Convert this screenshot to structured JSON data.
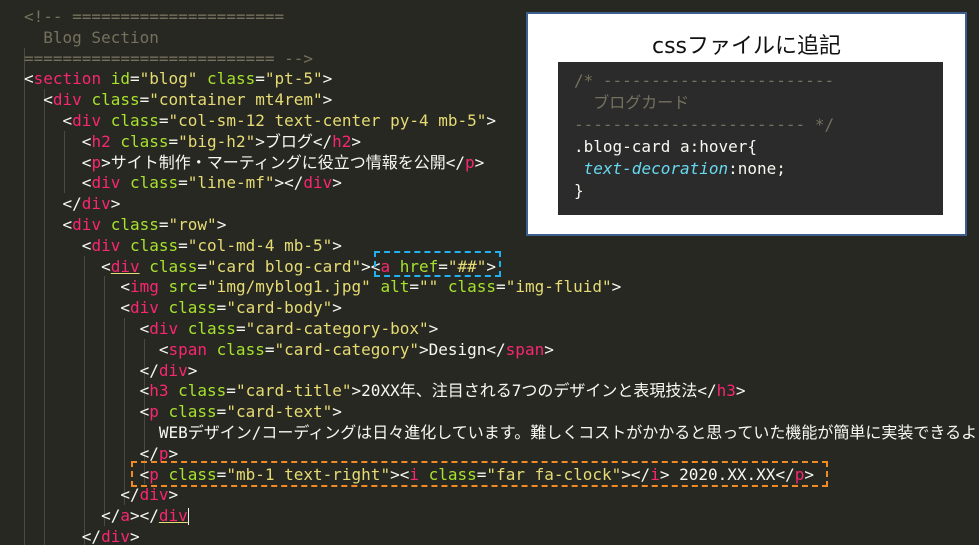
{
  "editor": {
    "lines": [
      [
        {
          "c": "cm",
          "t": "<!-- ======================"
        }
      ],
      [
        {
          "c": "cm",
          "t": "  Blog Section"
        }
      ],
      [
        {
          "c": "cm",
          "t": "========================== -->"
        }
      ],
      [
        {
          "c": "pu",
          "t": "<"
        },
        {
          "c": "tg",
          "t": "section"
        },
        {
          "c": "at",
          "t": " id"
        },
        {
          "c": "pu",
          "t": "="
        },
        {
          "c": "st",
          "t": "\"blog\""
        },
        {
          "c": "at",
          "t": " class"
        },
        {
          "c": "pu",
          "t": "="
        },
        {
          "c": "st",
          "t": "\"pt-5\""
        },
        {
          "c": "pu",
          "t": ">"
        }
      ],
      [
        {
          "c": "pu",
          "t": "  <"
        },
        {
          "c": "tg",
          "t": "div"
        },
        {
          "c": "at",
          "t": " class"
        },
        {
          "c": "pu",
          "t": "="
        },
        {
          "c": "st",
          "t": "\"container mt4rem\""
        },
        {
          "c": "pu",
          "t": ">"
        }
      ],
      [
        {
          "c": "pu",
          "t": "    <"
        },
        {
          "c": "tg",
          "t": "div"
        },
        {
          "c": "at",
          "t": " class"
        },
        {
          "c": "pu",
          "t": "="
        },
        {
          "c": "st",
          "t": "\"col-sm-12 text-center py-4 mb-5\""
        },
        {
          "c": "pu",
          "t": ">"
        }
      ],
      [
        {
          "c": "pu",
          "t": "      <"
        },
        {
          "c": "tg",
          "t": "h2"
        },
        {
          "c": "at",
          "t": " class"
        },
        {
          "c": "pu",
          "t": "="
        },
        {
          "c": "st",
          "t": "\"big-h2\""
        },
        {
          "c": "pu",
          "t": ">"
        },
        {
          "c": "tx",
          "t": "ブログ"
        },
        {
          "c": "pu",
          "t": "</"
        },
        {
          "c": "tg",
          "t": "h2"
        },
        {
          "c": "pu",
          "t": ">"
        }
      ],
      [
        {
          "c": "pu",
          "t": "      <"
        },
        {
          "c": "tg",
          "t": "p"
        },
        {
          "c": "pu",
          "t": ">"
        },
        {
          "c": "tx",
          "t": "サイト制作・マーティングに役立つ情報を公開"
        },
        {
          "c": "pu",
          "t": "</"
        },
        {
          "c": "tg",
          "t": "p"
        },
        {
          "c": "pu",
          "t": ">"
        }
      ],
      [
        {
          "c": "pu",
          "t": "      <"
        },
        {
          "c": "tg",
          "t": "div"
        },
        {
          "c": "at",
          "t": " class"
        },
        {
          "c": "pu",
          "t": "="
        },
        {
          "c": "st",
          "t": "\"line-mf\""
        },
        {
          "c": "pu",
          "t": "></"
        },
        {
          "c": "tg",
          "t": "div"
        },
        {
          "c": "pu",
          "t": ">"
        }
      ],
      [
        {
          "c": "pu",
          "t": "    </"
        },
        {
          "c": "tg",
          "t": "div"
        },
        {
          "c": "pu",
          "t": ">"
        }
      ],
      [
        {
          "c": "pu",
          "t": "    <"
        },
        {
          "c": "tg",
          "t": "div"
        },
        {
          "c": "at",
          "t": " class"
        },
        {
          "c": "pu",
          "t": "="
        },
        {
          "c": "st",
          "t": "\"row\""
        },
        {
          "c": "pu",
          "t": ">"
        }
      ],
      [
        {
          "c": "pu",
          "t": "      <"
        },
        {
          "c": "tg",
          "t": "div"
        },
        {
          "c": "at",
          "t": " class"
        },
        {
          "c": "pu",
          "t": "="
        },
        {
          "c": "st",
          "t": "\"col-md-4 mb-5\""
        },
        {
          "c": "pu",
          "t": ">"
        }
      ],
      [
        {
          "c": "pu",
          "t": "        <"
        },
        {
          "c": "tg ul",
          "t": "div"
        },
        {
          "c": "at",
          "t": " class"
        },
        {
          "c": "pu",
          "t": "="
        },
        {
          "c": "st",
          "t": "\"card blog-card\""
        },
        {
          "c": "pu",
          "t": "><"
        },
        {
          "c": "tg",
          "t": "a"
        },
        {
          "c": "at",
          "t": " href"
        },
        {
          "c": "pu",
          "t": "="
        },
        {
          "c": "st",
          "t": "\"##\""
        },
        {
          "c": "pu",
          "t": ">"
        }
      ],
      [
        {
          "c": "pu",
          "t": "          <"
        },
        {
          "c": "tg",
          "t": "img"
        },
        {
          "c": "at",
          "t": " src"
        },
        {
          "c": "pu",
          "t": "="
        },
        {
          "c": "st",
          "t": "\"img/myblog1.jpg\""
        },
        {
          "c": "at",
          "t": " alt"
        },
        {
          "c": "pu",
          "t": "="
        },
        {
          "c": "st",
          "t": "\"\""
        },
        {
          "c": "at",
          "t": " class"
        },
        {
          "c": "pu",
          "t": "="
        },
        {
          "c": "st",
          "t": "\"img-fluid\""
        },
        {
          "c": "pu",
          "t": ">"
        }
      ],
      [
        {
          "c": "pu",
          "t": "          <"
        },
        {
          "c": "tg",
          "t": "div"
        },
        {
          "c": "at",
          "t": " class"
        },
        {
          "c": "pu",
          "t": "="
        },
        {
          "c": "st",
          "t": "\"card-body\""
        },
        {
          "c": "pu",
          "t": ">"
        }
      ],
      [
        {
          "c": "pu",
          "t": "            <"
        },
        {
          "c": "tg",
          "t": "div"
        },
        {
          "c": "at",
          "t": " class"
        },
        {
          "c": "pu",
          "t": "="
        },
        {
          "c": "st",
          "t": "\"card-category-box\""
        },
        {
          "c": "pu",
          "t": ">"
        }
      ],
      [
        {
          "c": "pu",
          "t": "              <"
        },
        {
          "c": "tg",
          "t": "span"
        },
        {
          "c": "at",
          "t": " class"
        },
        {
          "c": "pu",
          "t": "="
        },
        {
          "c": "st",
          "t": "\"card-category\""
        },
        {
          "c": "pu",
          "t": ">"
        },
        {
          "c": "tx",
          "t": "Design"
        },
        {
          "c": "pu",
          "t": "</"
        },
        {
          "c": "tg",
          "t": "span"
        },
        {
          "c": "pu",
          "t": ">"
        }
      ],
      [
        {
          "c": "pu",
          "t": "            </"
        },
        {
          "c": "tg",
          "t": "div"
        },
        {
          "c": "pu",
          "t": ">"
        }
      ],
      [
        {
          "c": "pu",
          "t": "            <"
        },
        {
          "c": "tg",
          "t": "h3"
        },
        {
          "c": "at",
          "t": " class"
        },
        {
          "c": "pu",
          "t": "="
        },
        {
          "c": "st",
          "t": "\"card-title\""
        },
        {
          "c": "pu",
          "t": ">"
        },
        {
          "c": "tx",
          "t": "20XX年、注目される7つのデザインと表現技法"
        },
        {
          "c": "pu",
          "t": "</"
        },
        {
          "c": "tg",
          "t": "h3"
        },
        {
          "c": "pu",
          "t": ">"
        }
      ],
      [
        {
          "c": "pu",
          "t": "            <"
        },
        {
          "c": "tg",
          "t": "p"
        },
        {
          "c": "at",
          "t": " class"
        },
        {
          "c": "pu",
          "t": "="
        },
        {
          "c": "st",
          "t": "\"card-text\""
        },
        {
          "c": "pu",
          "t": ">"
        }
      ],
      [
        {
          "c": "tx",
          "t": "              WEBデザイン/コーディングは日々進化しています。難しくコストがかかると思っていた機能が簡単に実装できるように..."
        }
      ],
      [
        {
          "c": "pu",
          "t": "            </"
        },
        {
          "c": "tg",
          "t": "p"
        },
        {
          "c": "pu",
          "t": ">"
        }
      ],
      [
        {
          "c": "pu",
          "t": "            <"
        },
        {
          "c": "tg",
          "t": "p"
        },
        {
          "c": "at",
          "t": " class"
        },
        {
          "c": "pu",
          "t": "="
        },
        {
          "c": "st",
          "t": "\"mb-1 text-right\""
        },
        {
          "c": "pu",
          "t": "><"
        },
        {
          "c": "tg",
          "t": "i"
        },
        {
          "c": "at",
          "t": " class"
        },
        {
          "c": "pu",
          "t": "="
        },
        {
          "c": "st",
          "t": "\"far fa-clock\""
        },
        {
          "c": "pu",
          "t": "></"
        },
        {
          "c": "tg",
          "t": "i"
        },
        {
          "c": "pu",
          "t": ">"
        },
        {
          "c": "tx",
          "t": " 2020.XX.XX"
        },
        {
          "c": "pu",
          "t": "</"
        },
        {
          "c": "tg",
          "t": "p"
        },
        {
          "c": "pu",
          "t": ">"
        }
      ],
      [
        {
          "c": "pu",
          "t": "          </"
        },
        {
          "c": "tg",
          "t": "div"
        },
        {
          "c": "pu",
          "t": ">"
        }
      ],
      [
        {
          "c": "pu",
          "t": "        </"
        },
        {
          "c": "tg",
          "t": "a"
        },
        {
          "c": "pu",
          "t": "></"
        },
        {
          "c": "tg ul",
          "t": "div"
        },
        {
          "c": "cursor",
          "t": ""
        }
      ],
      [
        {
          "c": "pu",
          "t": "      </"
        },
        {
          "c": "tg",
          "t": "div"
        },
        {
          "c": "pu",
          "t": ">"
        }
      ]
    ]
  },
  "callout": {
    "title": "cssファイルに追記",
    "snippet": {
      "comment_open": "/* ------------------------",
      "comment_body": "  ブログカード",
      "comment_close": "------------------------ */",
      "selector": ".blog-card a:hover{",
      "property": "text-decoration",
      "value": ":none;",
      "close": "}"
    }
  },
  "colors": {
    "editor_bg": "#272822",
    "tag": "#f92672",
    "attribute": "#a6e22e",
    "string": "#e6db74",
    "comment": "#75715e",
    "highlight_blue": "#1fb1f0",
    "highlight_orange": "#f08a24"
  }
}
